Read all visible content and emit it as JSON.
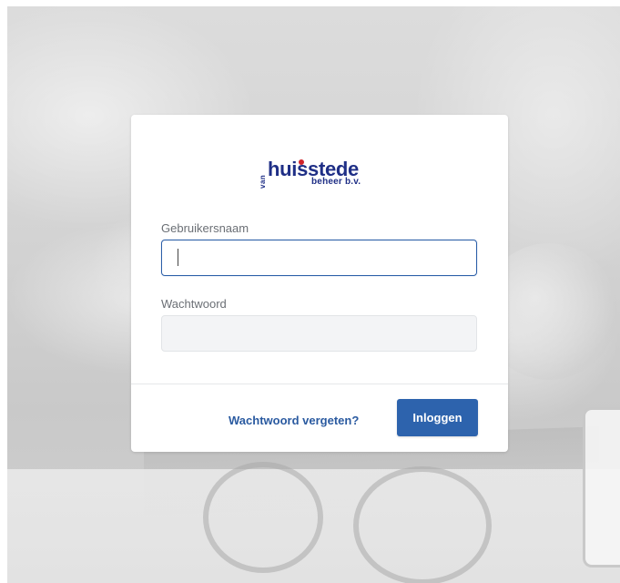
{
  "logo": {
    "prefix": "van",
    "brand": "huisstede",
    "sub": "beheer b.v."
  },
  "form": {
    "username_label": "Gebruikersnaam",
    "username_value": "",
    "password_label": "Wachtwoord",
    "password_value": ""
  },
  "actions": {
    "forgot_label": "Wachtwoord vergeten?",
    "login_label": "Inloggen"
  },
  "colors": {
    "primary": "#2d63ad",
    "link": "#2a5aa0",
    "brand": "#1f2f86",
    "brand_dot": "#d0232a"
  }
}
